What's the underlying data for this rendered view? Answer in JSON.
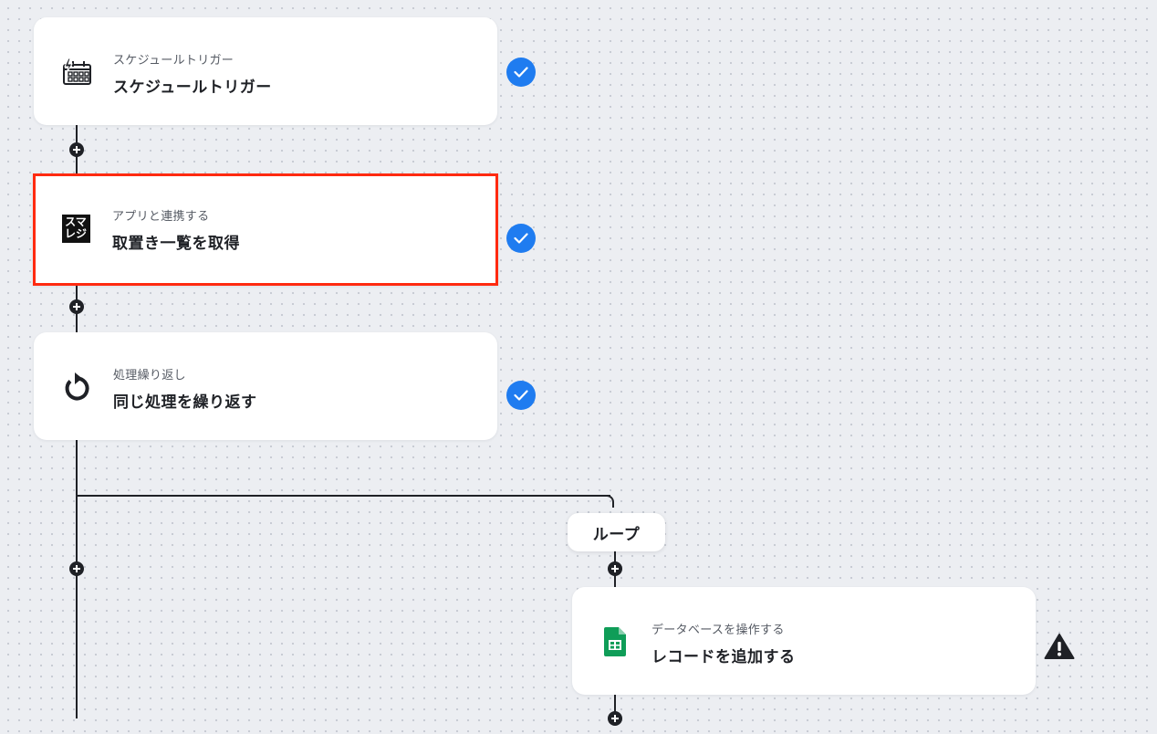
{
  "colors": {
    "accent_check": "#1f7cf0",
    "selection_border": "#ff2a10",
    "connector": "#1f2126",
    "sheets_green": "#0f9d58"
  },
  "steps": [
    {
      "subtitle": "スケジュールトリガー",
      "title": "スケジュールトリガー",
      "icon": "calendar-bolt-icon",
      "status": "check-icon"
    },
    {
      "subtitle": "アプリと連携する",
      "title": "取置き一覧を取得",
      "icon": "smaregi-logo",
      "logo_text": [
        "スマ",
        "レジ"
      ],
      "status": "check-icon",
      "selected": true
    },
    {
      "subtitle": "処理繰り返し",
      "title": "同じ処理を繰り返す",
      "icon": "repeat-icon",
      "status": "check-icon"
    }
  ],
  "loop": {
    "label": "ループ"
  },
  "loop_steps": [
    {
      "subtitle": "データベースを操作する",
      "title": "レコードを追加する",
      "icon": "google-sheets-icon",
      "status": "warning-icon"
    }
  ]
}
